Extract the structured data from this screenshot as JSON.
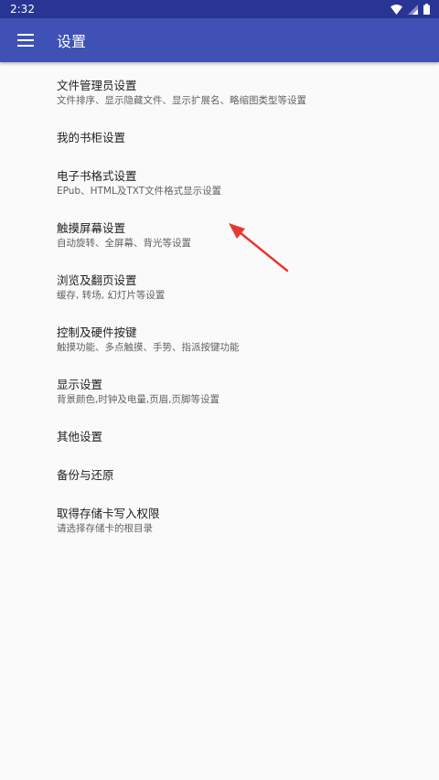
{
  "status_bar": {
    "time": "2:32"
  },
  "app_bar": {
    "title": "设置",
    "menu_icon": "hamburger-menu-icon"
  },
  "settings": [
    {
      "title": "文件管理员设置",
      "summary": "文件排序、显示隐藏文件、显示扩展名、略缩图类型等设置"
    },
    {
      "title": "我的书柜设置",
      "summary": ""
    },
    {
      "title": "电子书格式设置",
      "summary": "EPub、HTML及TXT文件格式显示设置"
    },
    {
      "title": "触摸屏幕设置",
      "summary": "自动旋转、全屏幕、背光等设置"
    },
    {
      "title": "浏览及翻页设置",
      "summary": "缓存, 转场, 幻灯片等设置"
    },
    {
      "title": "控制及硬件按键",
      "summary": "触摸功能、多点触摸、手势、指派按键功能"
    },
    {
      "title": "显示设置",
      "summary": "背景颜色,时钟及电量,页眉,页脚等设置"
    },
    {
      "title": "其他设置",
      "summary": ""
    },
    {
      "title": "备份与还原",
      "summary": ""
    },
    {
      "title": "取得存储卡写入权限",
      "summary": "请选择存储卡的根目录"
    }
  ],
  "colors": {
    "status_bar": "#283593",
    "app_bar": "#3f51b5",
    "background": "#fafafa",
    "annotation_arrow": "#e53935"
  }
}
